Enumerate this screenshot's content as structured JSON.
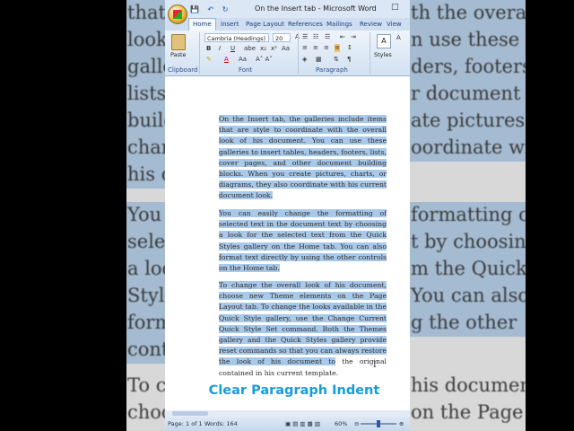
{
  "window": {
    "title": "On the Insert tab - Microsoft Word",
    "qat": [
      "💾",
      "↶",
      "↻"
    ],
    "controls": [
      "–",
      "□"
    ]
  },
  "ribbon": {
    "tabs": [
      "Home",
      "Insert",
      "Page Layout",
      "References",
      "Mailings",
      "Review",
      "View"
    ],
    "clipboard": {
      "paste": "Paste",
      "label": "Clipboard"
    },
    "font": {
      "name": "Cambria (Headings)",
      "size": "20",
      "label": "Font"
    },
    "paragraph": {
      "label": "Paragraph"
    },
    "styles": {
      "label": "Styles"
    }
  },
  "background_text": [
    "that a",
    "look o",
    "galler",
    "lists,",
    "buildi",
    "charts",
    "his c",
    "You c",
    "select",
    "a loo",
    "Style",
    "forma",
    "contr",
    "To ch",
    "choos",
    "th the overall",
    "n use these",
    "ders, footers,",
    "r  document",
    "ate pictures,",
    "oordinate with",
    "formatting of",
    "t by choosing",
    "m the Quick",
    "You can also",
    "g  the  other",
    "his document,",
    "on  the  Page"
  ],
  "document": {
    "paragraphs": [
      "On the Insert tab, the galleries include items that are style to coordinate with the overall look of his document. You can use these galleries to insert tables, headers, footers, lists, cover pages, and other document building blocks. When you create pictures, charts, or diagrams, they also coordinate with his current document look.",
      "You can easily change the formatting of selected text in the document text by choosing a look for the selected text from the Quick Styles gallery on the Home tab. You can also format text directly by using the other controls on the Home tab.",
      "To change the overall look of his document, choose new Theme elements on the Page Layout tab. To change the looks available in the Quick Style gallery, use the Change Current Quick Style Set command. Both the Themes gallery and the Quick Styles gallery provide reset commands so that you can always restore the look of his document to"
    ],
    "para3_tail": " the original contained in his current template."
  },
  "caption": "Clear Paragraph Indent",
  "status_bar": {
    "page": "Page: 1 of 1",
    "words": "Words: 164",
    "zoom": "60%"
  }
}
